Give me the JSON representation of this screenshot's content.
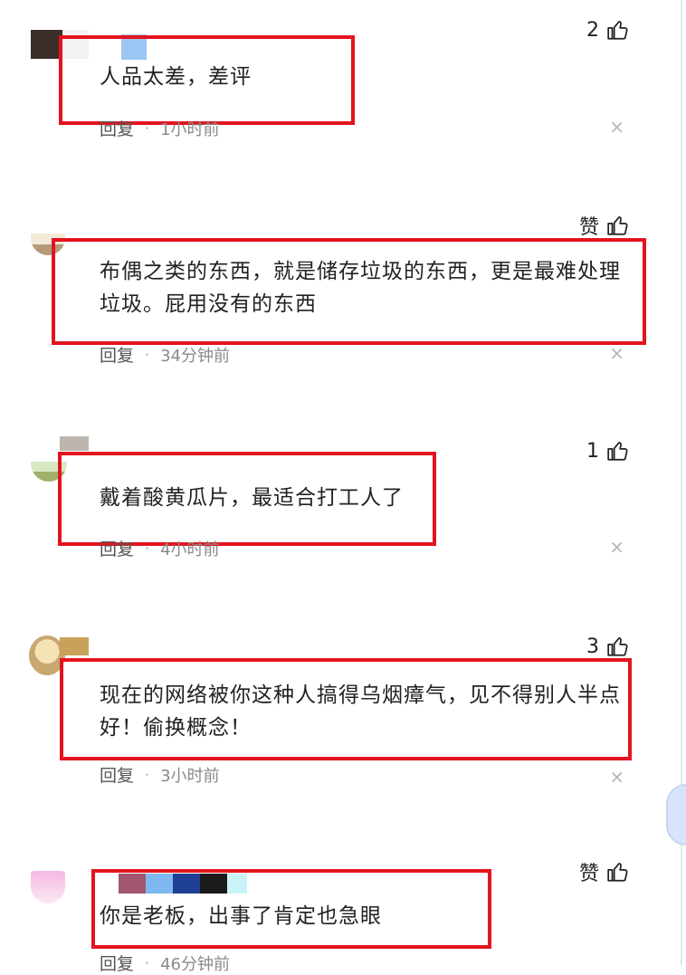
{
  "colors": {
    "highlight_box": "#e3141f",
    "scroll_knob": "#d7e4fb"
  },
  "icons": {
    "like": "thumbs-up-icon",
    "close": "close-x-icon"
  },
  "comments": [
    {
      "likes": "2",
      "text": "人品太差，差评",
      "reply_label": "回复",
      "time": "1小时前",
      "close_glyph": "×"
    },
    {
      "likes": "赞",
      "text": "布偶之类的东西，就是储存垃圾的东西，更是最难处理垃圾。屁用没有的东西",
      "reply_label": "回复",
      "time": "34分钟前",
      "close_glyph": "×"
    },
    {
      "likes": "1",
      "text": "戴着酸黄瓜片，最适合打工人了",
      "reply_label": "回复",
      "time": "4小时前",
      "close_glyph": "×"
    },
    {
      "likes": "3",
      "text": "现在的网络被你这种人搞得乌烟瘴气，见不得别人半点好！偷换概念！",
      "reply_label": "回复",
      "time": "3小时前",
      "close_glyph": "×"
    },
    {
      "likes": "赞",
      "text": "你是老板，出事了肯定也急眼",
      "reply_label": "回复",
      "time": "46分钟前",
      "close_glyph": "×"
    }
  ]
}
